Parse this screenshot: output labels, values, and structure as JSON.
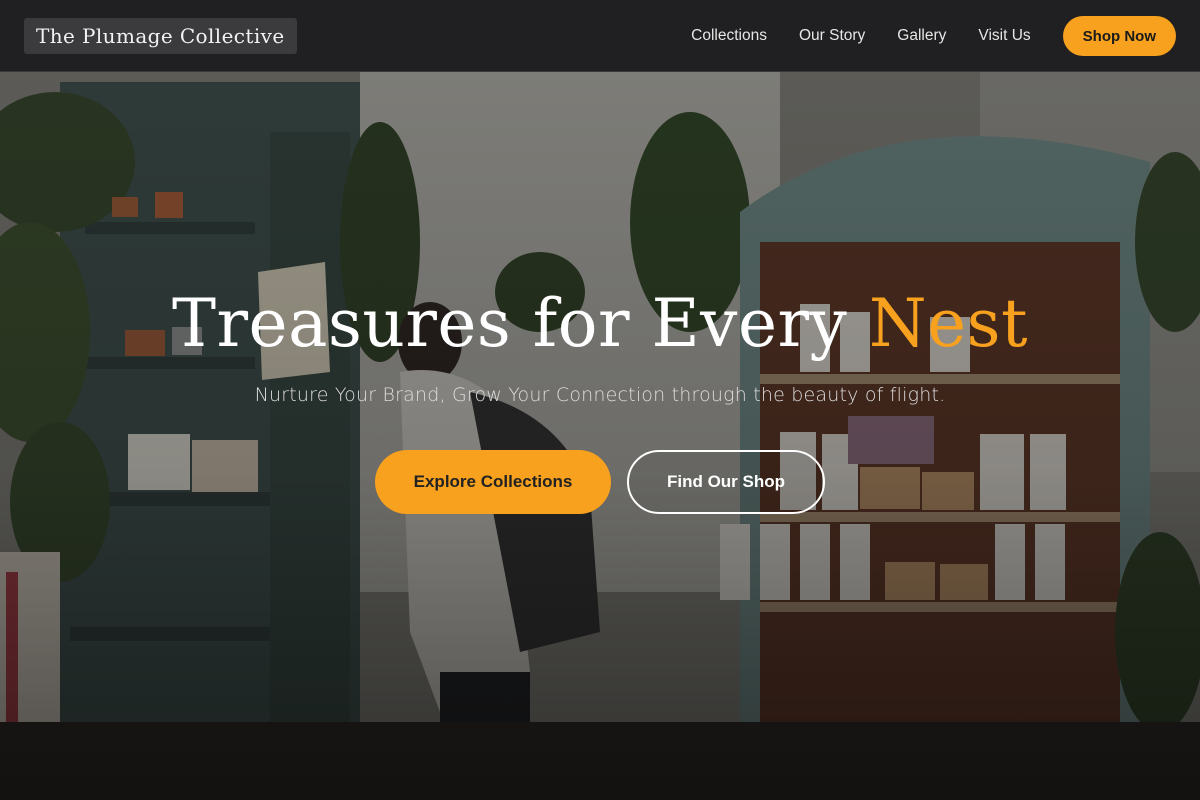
{
  "brand": {
    "name": "The Plumage Collective"
  },
  "nav": {
    "links": [
      "Collections",
      "Our Story",
      "Gallery",
      "Visit Us"
    ],
    "cta": "Shop Now"
  },
  "hero": {
    "title_main": "Treasures for Every ",
    "title_accent": "Nest",
    "subtitle": "Nurture Your Brand, Grow Your Connection through the beauty of flight.",
    "primary_button": "Explore Collections",
    "secondary_button": "Find Our Shop",
    "background_description_icon": "shop-interior-photo"
  },
  "colors": {
    "accent": "#f7a11e",
    "nav_bg": "#202022",
    "text_light": "#ffffff"
  }
}
